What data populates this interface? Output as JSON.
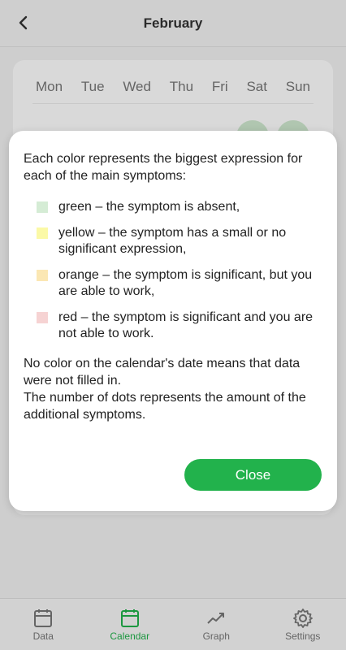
{
  "header": {
    "title": "February"
  },
  "calendar": {
    "weekdays": [
      "Mon",
      "Tue",
      "Wed",
      "Thu",
      "Fri",
      "Sat",
      "Sun"
    ]
  },
  "dialog": {
    "intro": "Each color represents the biggest expression for each of the main symptoms:",
    "legend": [
      {
        "color": "#d5ecd5",
        "text": "green – the symptom is absent,"
      },
      {
        "color": "#fbf9a6",
        "text": "yellow – the symptom has a small or no significant expression,"
      },
      {
        "color": "#fbe7b3",
        "text": "orange – the symptom is significant, but you are able to work,"
      },
      {
        "color": "#f6d3d3",
        "text": "red – the symptom is significant and you are not able to work."
      }
    ],
    "note_1": "No color on the calendar's date means that data were not filled in.",
    "note_2": "The number of dots represents the amount of the additional symptoms.",
    "close_label": "Close"
  },
  "bottom_nav": {
    "items": [
      {
        "label": "Data",
        "icon": "calendar-blank-icon",
        "active": false
      },
      {
        "label": "Calendar",
        "icon": "calendar-icon",
        "active": true
      },
      {
        "label": "Graph",
        "icon": "trend-graph-icon",
        "active": false
      },
      {
        "label": "Settings",
        "icon": "gear-icon",
        "active": false
      }
    ]
  },
  "colors": {
    "accent": "#22b24c"
  }
}
